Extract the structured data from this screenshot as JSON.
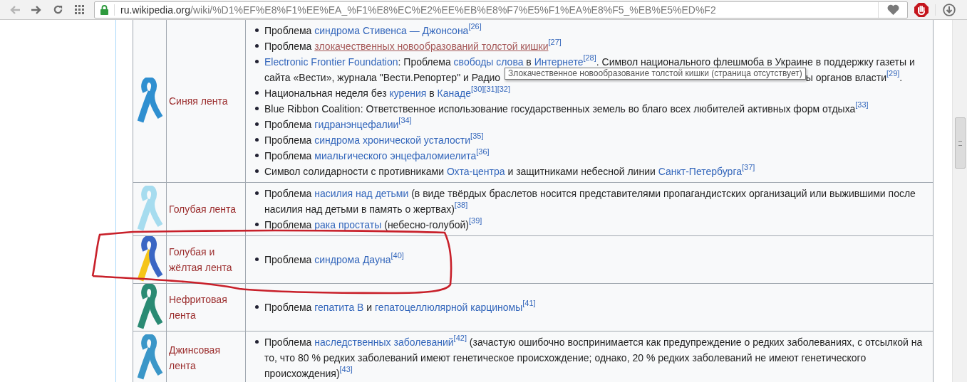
{
  "browser": {
    "url_host": "ru.wikipedia.org",
    "url_path": "/wiki/%D1%EF%E8%F1%EE%EA_%F1%E8%EC%E2%EE%EB%E8%F7%E5%F1%EA%E8%F5_%EB%E5%ED%F2"
  },
  "rows": [
    {
      "name": "Синяя лента",
      "ribbon": [
        {
          "color": "#2f8fd0"
        }
      ],
      "items": [
        [
          {
            "kind": "text",
            "text": "Проблема "
          },
          {
            "kind": "link",
            "text": "синдрома Стивенса — Джонсона"
          },
          {
            "kind": "ref",
            "text": "[26]"
          }
        ],
        [
          {
            "kind": "text",
            "text": "Проблема "
          },
          {
            "kind": "redlink",
            "text": "злокачественных новообразований толстой кишки"
          },
          {
            "kind": "ref",
            "text": "[27]"
          }
        ],
        [
          {
            "kind": "link",
            "text": "Electronic Frontier Foundation"
          },
          {
            "kind": "text",
            "text": ": Проблема "
          },
          {
            "kind": "link",
            "text": "свободы слова"
          },
          {
            "kind": "text",
            "text": " в "
          },
          {
            "kind": "link",
            "text": "Интернете"
          },
          {
            "kind": "ref",
            "text": "[28]"
          },
          {
            "kind": "text",
            "text": ". Символ национального флешмоба в Украине в поддержку газеты и сайта «Вести», журнала \"Вести.Репортер\" и Радио "
          },
          {
            "kind": "tooltip",
            "text": "Злокачественное новообразование толстой кишки (страница отсутствует)"
          },
          {
            "kind": "text",
            "text": "ы органов власти"
          },
          {
            "kind": "ref",
            "text": "[29]"
          },
          {
            "kind": "text",
            "text": "."
          }
        ],
        [
          {
            "kind": "text",
            "text": "Национальная неделя без "
          },
          {
            "kind": "link",
            "text": "курения"
          },
          {
            "kind": "text",
            "text": " в "
          },
          {
            "kind": "link",
            "text": "Канаде"
          },
          {
            "kind": "ref",
            "text": "[30]"
          },
          {
            "kind": "ref",
            "text": "[31]"
          },
          {
            "kind": "ref",
            "text": "[32]"
          }
        ],
        [
          {
            "kind": "text",
            "text": "Blue Ribbon Coalition: Ответственное использование государственных земель во благо всех любителей активных форм отдыха"
          },
          {
            "kind": "ref",
            "text": "[33]"
          }
        ],
        [
          {
            "kind": "text",
            "text": "Проблема "
          },
          {
            "kind": "link",
            "text": "гидранэнцефалии"
          },
          {
            "kind": "ref",
            "text": "[34]"
          }
        ],
        [
          {
            "kind": "text",
            "text": "Проблема "
          },
          {
            "kind": "link",
            "text": "синдрома хронической усталости"
          },
          {
            "kind": "ref",
            "text": "[35]"
          }
        ],
        [
          {
            "kind": "text",
            "text": "Проблема "
          },
          {
            "kind": "link",
            "text": "миальгического энцефаломиелита"
          },
          {
            "kind": "ref",
            "text": "[36]"
          }
        ],
        [
          {
            "kind": "text",
            "text": "Символ солидарности с противниками "
          },
          {
            "kind": "link",
            "text": "Охта-центра"
          },
          {
            "kind": "text",
            "text": " и защитниками небесной линии "
          },
          {
            "kind": "link",
            "text": "Санкт-Петербурга"
          },
          {
            "kind": "ref",
            "text": "[37]"
          }
        ]
      ]
    },
    {
      "name": "Голубая лента",
      "ribbon": [
        {
          "color": "#a6dcef"
        }
      ],
      "items": [
        [
          {
            "kind": "text",
            "text": "Проблема "
          },
          {
            "kind": "link",
            "text": "насилия над детьми"
          },
          {
            "kind": "text",
            "text": " (в виде твёрдых браслетов носится представителями пропагандистских организаций или выжившими после насилия над детьми в память о жертвах)"
          },
          {
            "kind": "ref",
            "text": "[38]"
          }
        ],
        [
          {
            "kind": "text",
            "text": "Проблема "
          },
          {
            "kind": "link",
            "text": "рака простаты"
          },
          {
            "kind": "text",
            "text": " (небесно-голубой)"
          },
          {
            "kind": "ref",
            "text": "[39]"
          }
        ]
      ]
    },
    {
      "name": "Голубая и жёлтая лента",
      "ribbon": [
        {
          "color": "#3a66c4"
        },
        {
          "color": "#f5c518"
        }
      ],
      "items": [
        [
          {
            "kind": "text",
            "text": "Проблема "
          },
          {
            "kind": "link",
            "text": "синдрома Дауна"
          },
          {
            "kind": "ref",
            "text": "[40]"
          }
        ]
      ]
    },
    {
      "name": "Нефритовая лента",
      "ribbon": [
        {
          "color": "#2a8a73"
        }
      ],
      "items": [
        [
          {
            "kind": "text",
            "text": "Проблема "
          },
          {
            "kind": "link",
            "text": "гепатита B"
          },
          {
            "kind": "text",
            "text": " и "
          },
          {
            "kind": "link",
            "text": "гепатоцеллюлярной карциномы"
          },
          {
            "kind": "ref",
            "text": "[41]"
          }
        ]
      ]
    },
    {
      "name": "Джинсовая лента",
      "ribbon": [
        {
          "color": "#3a96c8"
        }
      ],
      "items": [
        [
          {
            "kind": "text",
            "text": "Проблема "
          },
          {
            "kind": "link",
            "text": "наследственных заболеваний"
          },
          {
            "kind": "ref",
            "text": "[42]"
          },
          {
            "kind": "text",
            "text": " (зачастую ошибочно воспринимается как предупреждение о редких заболеваниях, с отсылкой на то, что 80 % редких заболеваний имеют генетическое происхождение; однако, 20 % редких заболеваний не имеют генетического происхождения)"
          },
          {
            "kind": "ref",
            "text": "[43]"
          }
        ]
      ]
    }
  ]
}
